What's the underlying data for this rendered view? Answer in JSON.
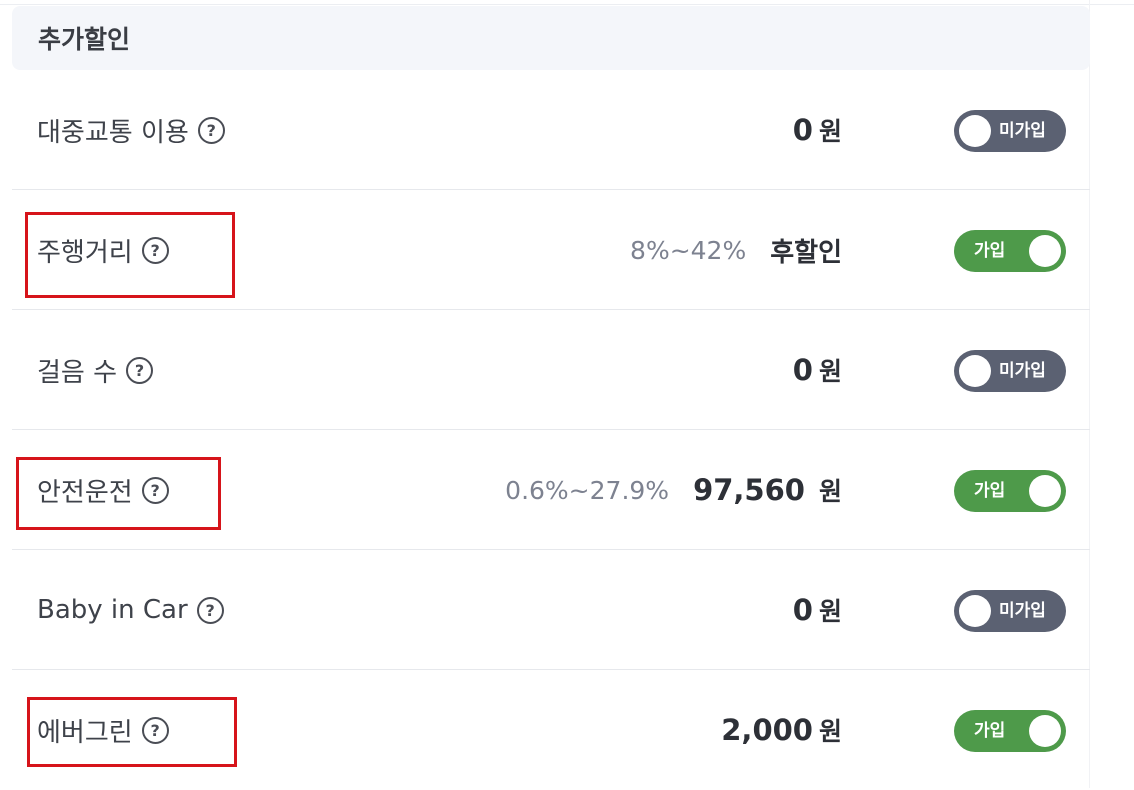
{
  "section": {
    "title": "추가할인"
  },
  "rows": [
    {
      "label": "대중교통 이용",
      "range": "",
      "amount": "0",
      "unit": "원",
      "toggle": {
        "state": "off",
        "text": "미가입"
      }
    },
    {
      "label": "주행거리",
      "range": "8%~42%",
      "amount": "후할인",
      "unit": "",
      "toggle": {
        "state": "on",
        "text": "가입"
      }
    },
    {
      "label": "걸음 수",
      "range": "",
      "amount": "0",
      "unit": "원",
      "toggle": {
        "state": "off",
        "text": "미가입"
      }
    },
    {
      "label": "안전운전",
      "range": "0.6%~27.9%",
      "amount": "97,560",
      "unit": "원",
      "toggle": {
        "state": "on",
        "text": "가입"
      }
    },
    {
      "label": "Baby in Car",
      "range": "",
      "amount": "0",
      "unit": "원",
      "toggle": {
        "state": "off",
        "text": "미가입"
      }
    },
    {
      "label": "에버그린",
      "range": "",
      "amount": "2,000",
      "unit": "원",
      "toggle": {
        "state": "on",
        "text": "가입"
      }
    }
  ],
  "help_icon": {
    "name": "question-circle-icon",
    "glyph": "?"
  },
  "colors": {
    "toggle_on": "#4e9a4a",
    "toggle_off": "#5b6172",
    "highlight": "#d6141a"
  }
}
